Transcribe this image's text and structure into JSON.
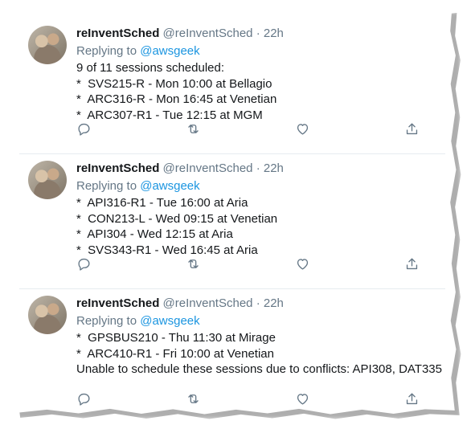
{
  "tweets": [
    {
      "name": "reInventSched",
      "handle": "@reInventSched",
      "separator": "·",
      "time": "22h",
      "replying_prefix": "Replying to ",
      "replying_to": "@awsgeek",
      "lines": [
        "9 of 11 sessions scheduled:",
        "*  SVS215-R - Mon 10:00 at Bellagio",
        "*  ARC316-R - Mon 16:45 at Venetian",
        "*  ARC307-R1 - Tue 12:15 at MGM"
      ]
    },
    {
      "name": "reInventSched",
      "handle": "@reInventSched",
      "separator": "·",
      "time": "22h",
      "replying_prefix": "Replying to ",
      "replying_to": "@awsgeek",
      "lines": [
        "*  API316-R1 - Tue 16:00 at Aria",
        "*  CON213-L - Wed 09:15 at Venetian",
        "*  API304 - Wed 12:15 at Aria",
        "*  SVS343-R1 - Wed 16:45 at Aria"
      ]
    },
    {
      "name": "reInventSched",
      "handle": "@reInventSched",
      "separator": "·",
      "time": "22h",
      "replying_prefix": "Replying to ",
      "replying_to": "@awsgeek",
      "lines": [
        "*  GPSBUS210 - Thu 11:30 at Mirage",
        "*  ARC410-R1 - Fri 10:00 at Venetian",
        "Unable to schedule these sessions due to conflicts: API308, DAT335",
        ""
      ]
    }
  ],
  "icons": [
    "reply-icon",
    "retweet-icon",
    "like-icon",
    "share-icon"
  ],
  "colors": {
    "text": "#14171a",
    "secondary": "#657786",
    "link": "#1b95e0",
    "divider": "#e6ecf0"
  }
}
